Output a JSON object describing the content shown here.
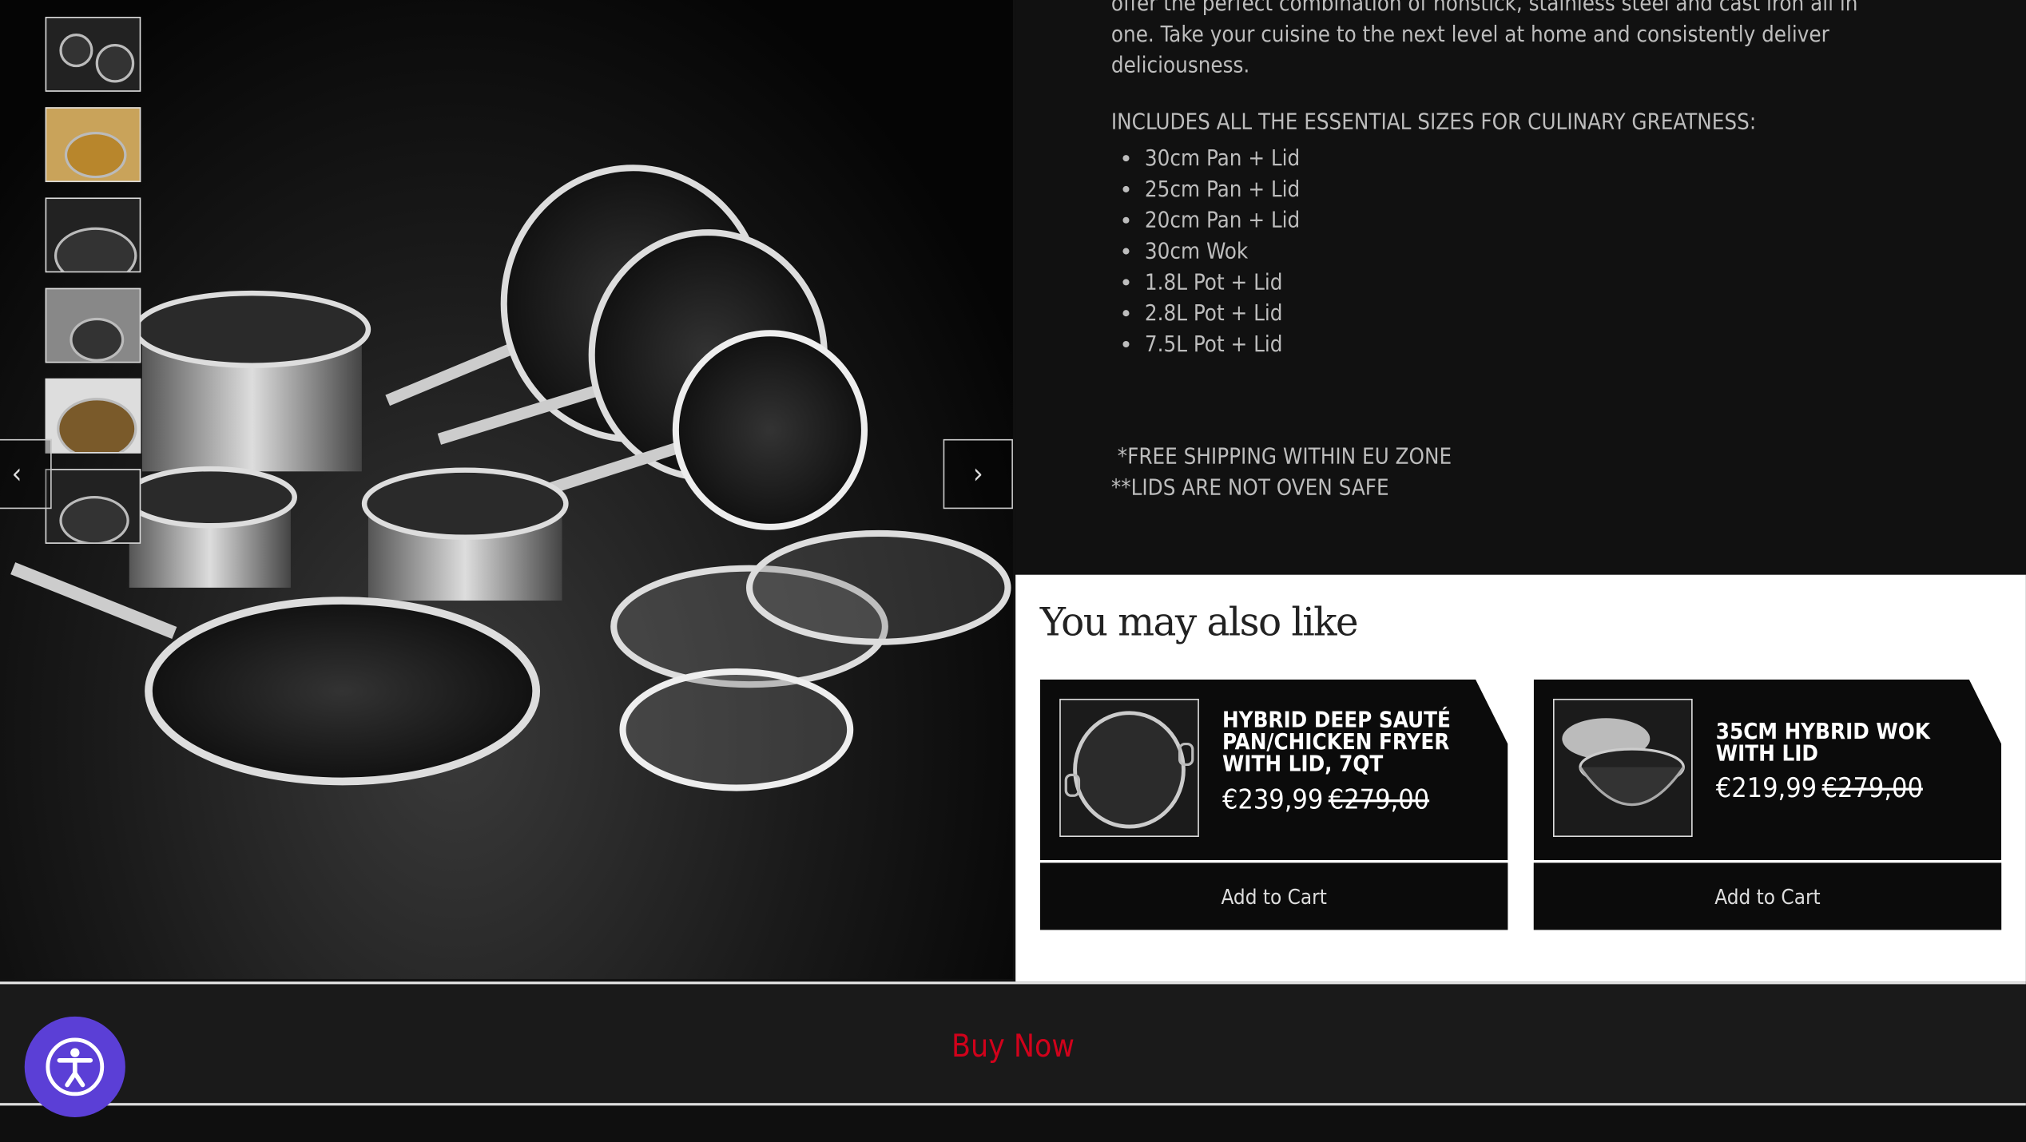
{
  "gallery": {
    "thumbnail_count": 6,
    "prev_icon": "chevron-left-icon",
    "next_icon": "chevron-right-icon"
  },
  "description": {
    "intro_lines": [
      "offer the perfect combination of nonstick, stainless steel and cast iron all in",
      "one. Take your cuisine to the next level at home and consistently deliver",
      "deliciousness."
    ],
    "sizes_heading": "INCLUDES ALL THE ESSENTIAL SIZES FOR CULINARY GREATNESS:",
    "sizes": [
      "30cm Pan + Lid",
      "25cm Pan + Lid",
      "20cm Pan + Lid",
      "30cm Wok",
      "1.8L Pot + Lid",
      "2.8L Pot + Lid",
      "7.5L Pot + Lid"
    ],
    "note_shipping": " *FREE SHIPPING WITHIN EU ZONE",
    "note_lids": "**LIDS ARE NOT OVEN SAFE"
  },
  "recommendations": {
    "heading": "You may also like",
    "items": [
      {
        "title": "HYBRID DEEP SAUTÉ PAN/CHICKEN FRYER WITH LID, 7QT",
        "price": "€239,99",
        "compare_price": "€279,00",
        "button": "Add to Cart"
      },
      {
        "title": "35CM HYBRID WOK WITH LID",
        "price": "€219,99",
        "compare_price": "€279,00",
        "button": "Add to Cart"
      }
    ]
  },
  "buy_bar": {
    "label": "Buy Now",
    "color": "#d0021b"
  },
  "accessibility": {
    "icon": "accessibility-icon",
    "color": "#5b3fd6"
  }
}
